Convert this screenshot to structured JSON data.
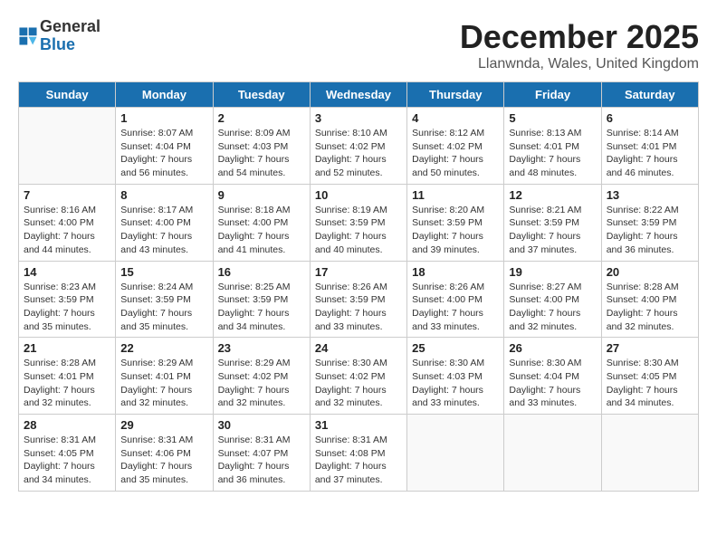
{
  "logo": {
    "general": "General",
    "blue": "Blue"
  },
  "header": {
    "month": "December 2025",
    "location": "Llanwnda, Wales, United Kingdom"
  },
  "days_of_week": [
    "Sunday",
    "Monday",
    "Tuesday",
    "Wednesday",
    "Thursday",
    "Friday",
    "Saturday"
  ],
  "weeks": [
    [
      {
        "day": "",
        "info": ""
      },
      {
        "day": "1",
        "info": "Sunrise: 8:07 AM\nSunset: 4:04 PM\nDaylight: 7 hours\nand 56 minutes."
      },
      {
        "day": "2",
        "info": "Sunrise: 8:09 AM\nSunset: 4:03 PM\nDaylight: 7 hours\nand 54 minutes."
      },
      {
        "day": "3",
        "info": "Sunrise: 8:10 AM\nSunset: 4:02 PM\nDaylight: 7 hours\nand 52 minutes."
      },
      {
        "day": "4",
        "info": "Sunrise: 8:12 AM\nSunset: 4:02 PM\nDaylight: 7 hours\nand 50 minutes."
      },
      {
        "day": "5",
        "info": "Sunrise: 8:13 AM\nSunset: 4:01 PM\nDaylight: 7 hours\nand 48 minutes."
      },
      {
        "day": "6",
        "info": "Sunrise: 8:14 AM\nSunset: 4:01 PM\nDaylight: 7 hours\nand 46 minutes."
      }
    ],
    [
      {
        "day": "7",
        "info": "Sunrise: 8:16 AM\nSunset: 4:00 PM\nDaylight: 7 hours\nand 44 minutes."
      },
      {
        "day": "8",
        "info": "Sunrise: 8:17 AM\nSunset: 4:00 PM\nDaylight: 7 hours\nand 43 minutes."
      },
      {
        "day": "9",
        "info": "Sunrise: 8:18 AM\nSunset: 4:00 PM\nDaylight: 7 hours\nand 41 minutes."
      },
      {
        "day": "10",
        "info": "Sunrise: 8:19 AM\nSunset: 3:59 PM\nDaylight: 7 hours\nand 40 minutes."
      },
      {
        "day": "11",
        "info": "Sunrise: 8:20 AM\nSunset: 3:59 PM\nDaylight: 7 hours\nand 39 minutes."
      },
      {
        "day": "12",
        "info": "Sunrise: 8:21 AM\nSunset: 3:59 PM\nDaylight: 7 hours\nand 37 minutes."
      },
      {
        "day": "13",
        "info": "Sunrise: 8:22 AM\nSunset: 3:59 PM\nDaylight: 7 hours\nand 36 minutes."
      }
    ],
    [
      {
        "day": "14",
        "info": "Sunrise: 8:23 AM\nSunset: 3:59 PM\nDaylight: 7 hours\nand 35 minutes."
      },
      {
        "day": "15",
        "info": "Sunrise: 8:24 AM\nSunset: 3:59 PM\nDaylight: 7 hours\nand 35 minutes."
      },
      {
        "day": "16",
        "info": "Sunrise: 8:25 AM\nSunset: 3:59 PM\nDaylight: 7 hours\nand 34 minutes."
      },
      {
        "day": "17",
        "info": "Sunrise: 8:26 AM\nSunset: 3:59 PM\nDaylight: 7 hours\nand 33 minutes."
      },
      {
        "day": "18",
        "info": "Sunrise: 8:26 AM\nSunset: 4:00 PM\nDaylight: 7 hours\nand 33 minutes."
      },
      {
        "day": "19",
        "info": "Sunrise: 8:27 AM\nSunset: 4:00 PM\nDaylight: 7 hours\nand 32 minutes."
      },
      {
        "day": "20",
        "info": "Sunrise: 8:28 AM\nSunset: 4:00 PM\nDaylight: 7 hours\nand 32 minutes."
      }
    ],
    [
      {
        "day": "21",
        "info": "Sunrise: 8:28 AM\nSunset: 4:01 PM\nDaylight: 7 hours\nand 32 minutes."
      },
      {
        "day": "22",
        "info": "Sunrise: 8:29 AM\nSunset: 4:01 PM\nDaylight: 7 hours\nand 32 minutes."
      },
      {
        "day": "23",
        "info": "Sunrise: 8:29 AM\nSunset: 4:02 PM\nDaylight: 7 hours\nand 32 minutes."
      },
      {
        "day": "24",
        "info": "Sunrise: 8:30 AM\nSunset: 4:02 PM\nDaylight: 7 hours\nand 32 minutes."
      },
      {
        "day": "25",
        "info": "Sunrise: 8:30 AM\nSunset: 4:03 PM\nDaylight: 7 hours\nand 33 minutes."
      },
      {
        "day": "26",
        "info": "Sunrise: 8:30 AM\nSunset: 4:04 PM\nDaylight: 7 hours\nand 33 minutes."
      },
      {
        "day": "27",
        "info": "Sunrise: 8:30 AM\nSunset: 4:05 PM\nDaylight: 7 hours\nand 34 minutes."
      }
    ],
    [
      {
        "day": "28",
        "info": "Sunrise: 8:31 AM\nSunset: 4:05 PM\nDaylight: 7 hours\nand 34 minutes."
      },
      {
        "day": "29",
        "info": "Sunrise: 8:31 AM\nSunset: 4:06 PM\nDaylight: 7 hours\nand 35 minutes."
      },
      {
        "day": "30",
        "info": "Sunrise: 8:31 AM\nSunset: 4:07 PM\nDaylight: 7 hours\nand 36 minutes."
      },
      {
        "day": "31",
        "info": "Sunrise: 8:31 AM\nSunset: 4:08 PM\nDaylight: 7 hours\nand 37 minutes."
      },
      {
        "day": "",
        "info": ""
      },
      {
        "day": "",
        "info": ""
      },
      {
        "day": "",
        "info": ""
      }
    ]
  ]
}
